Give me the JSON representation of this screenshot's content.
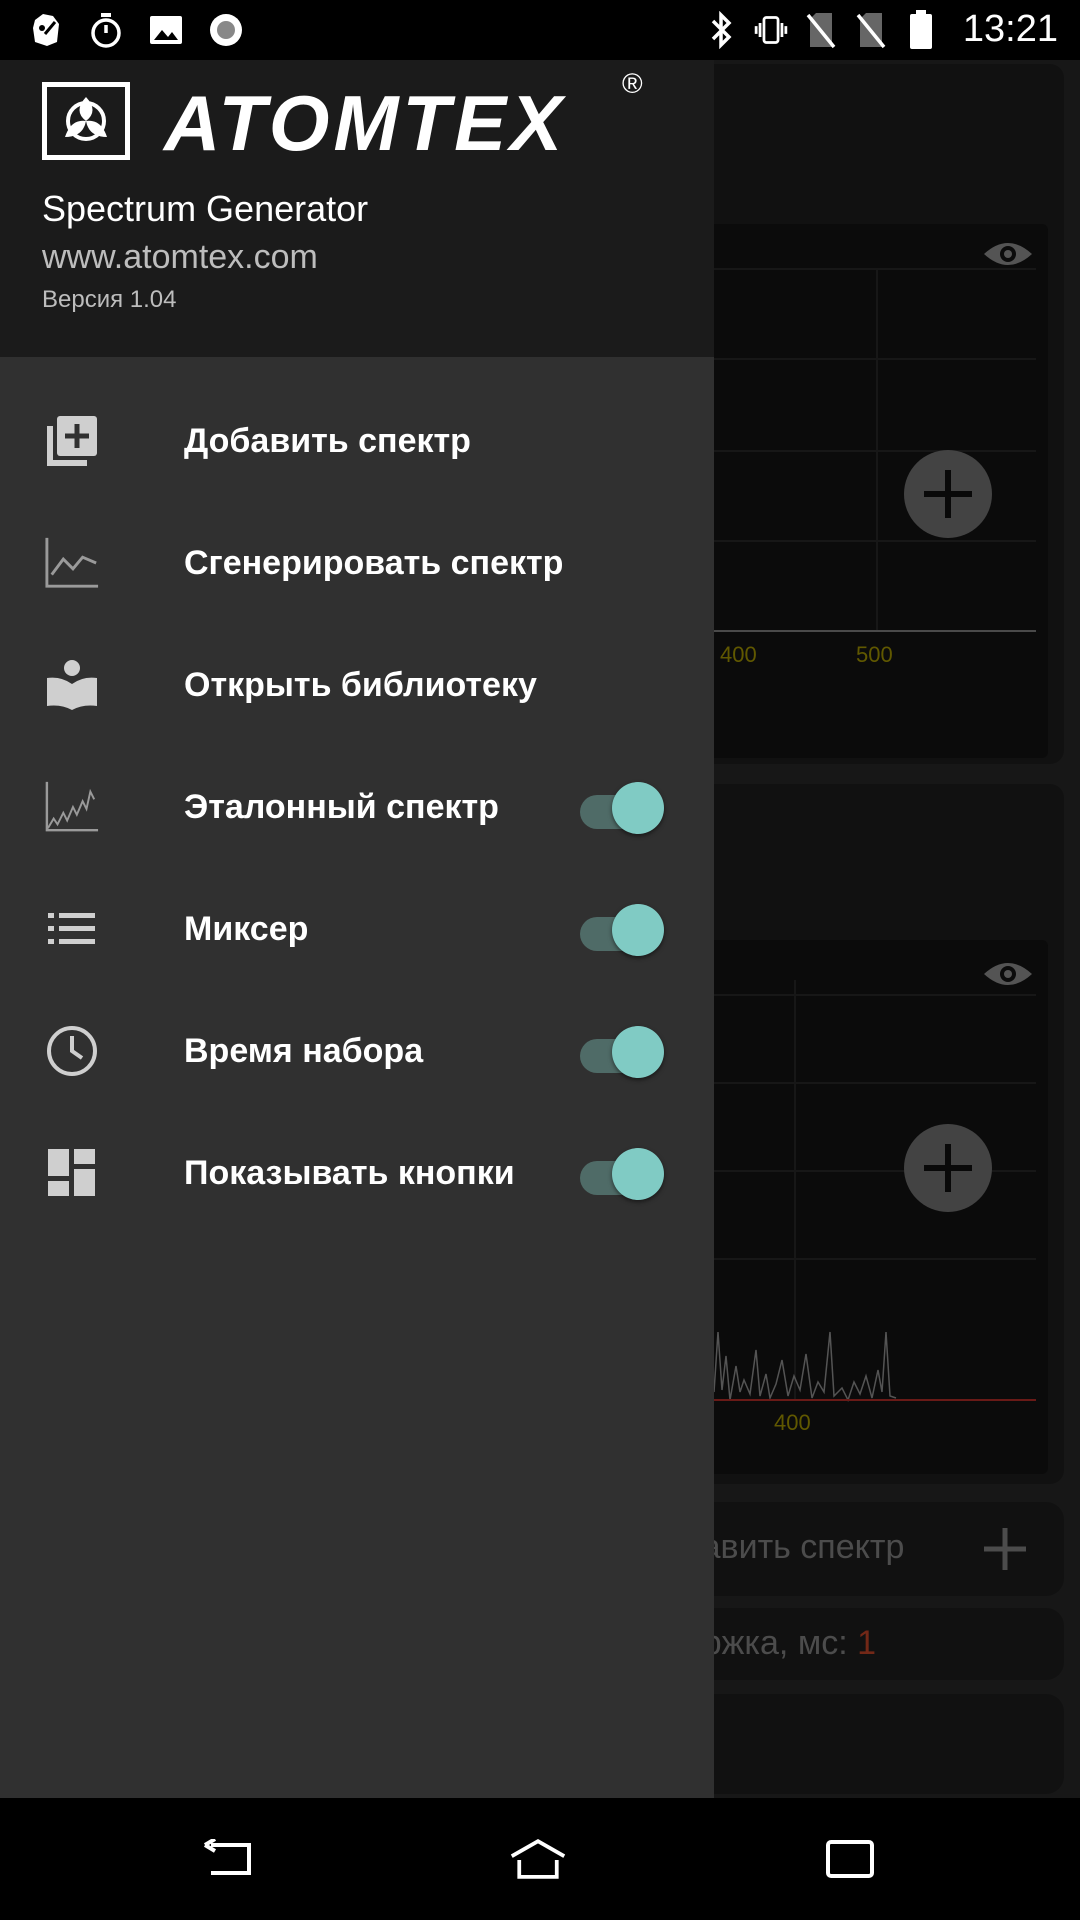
{
  "status_bar": {
    "time": "13:21",
    "left_icons": [
      "android-debug-icon",
      "stopwatch-icon",
      "image-icon",
      "record-icon"
    ],
    "right_icons": [
      "bluetooth-icon",
      "vibrate-icon",
      "no-sim-icon",
      "no-sim-icon",
      "battery-icon"
    ]
  },
  "background_app": {
    "chart1": {
      "ticks": [
        "400",
        "500"
      ]
    },
    "chart2": {
      "ticks": [
        "400"
      ]
    },
    "add_spectrum_label": "обавить спектр",
    "delay_label": "держка, мс:",
    "delay_value": "1"
  },
  "drawer": {
    "header": {
      "brand": "ATOMTEX",
      "registered_mark": "®",
      "app_name": "Spectrum Generator",
      "website": "www.atomtex.com",
      "version": "Версия 1.04"
    },
    "items": [
      {
        "label": "Добавить спектр",
        "icon": "add-library-icon",
        "toggle": null
      },
      {
        "label": "Сгенерировать спектр",
        "icon": "line-chart-icon",
        "toggle": null
      },
      {
        "label": "Открыть библиотеку",
        "icon": "book-reader-icon",
        "toggle": null
      },
      {
        "label": "Эталонный спектр",
        "icon": "spectrum-chart-icon",
        "toggle": true
      },
      {
        "label": "Миксер",
        "icon": "list-icon",
        "toggle": true
      },
      {
        "label": "Время набора",
        "icon": "clock-icon",
        "toggle": true
      },
      {
        "label": "Показывать кнопки",
        "icon": "dashboard-icon",
        "toggle": true
      }
    ]
  },
  "colors": {
    "toggle_thumb": "#80cbc4",
    "toggle_track": "#4f6b67",
    "drawer_bg": "#303030",
    "header_bg": "#1b1b1b",
    "delay_value": "#d24a2a",
    "tick_label": "#b0a000"
  }
}
